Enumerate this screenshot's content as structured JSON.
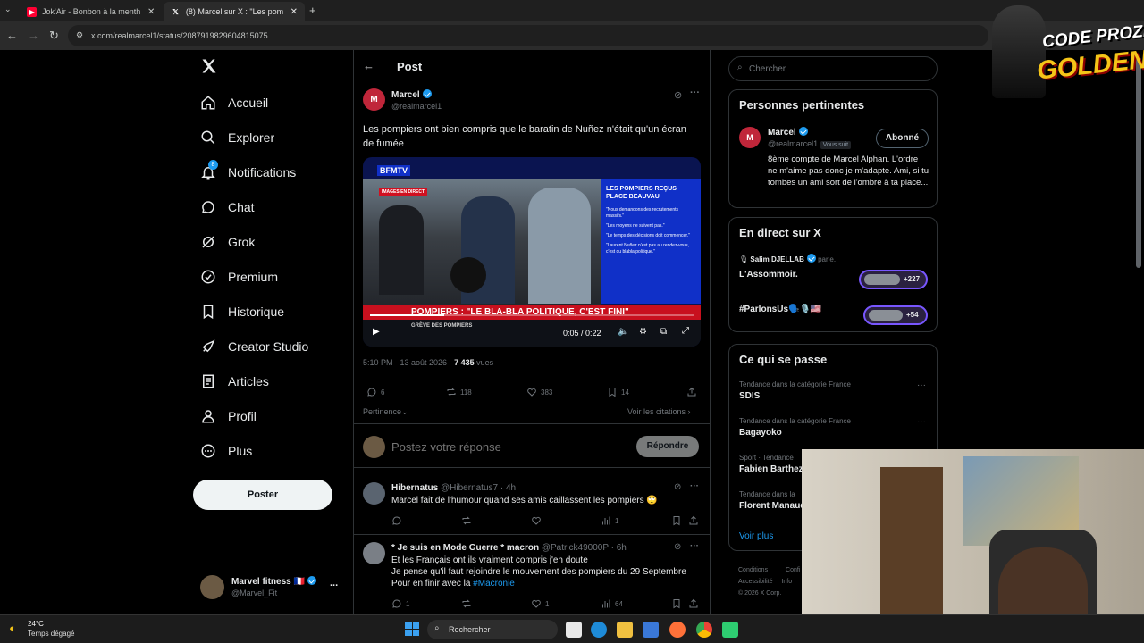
{
  "browser": {
    "tabs": [
      {
        "title": "Jok'Air - Bonbon à la menthe Ft",
        "active": false
      },
      {
        "title": "(8) Marcel sur X : \"Les pompiers",
        "active": true
      }
    ],
    "url": "x.com/realmarcel1/status/2087919829604815075"
  },
  "nav": {
    "items": [
      {
        "label": "Accueil",
        "icon": "home-icon"
      },
      {
        "label": "Explorer",
        "icon": "search-icon"
      },
      {
        "label": "Notifications",
        "icon": "bell-icon",
        "badge": "8"
      },
      {
        "label": "Chat",
        "icon": "chat-icon"
      },
      {
        "label": "Grok",
        "icon": "grok-icon"
      },
      {
        "label": "Premium",
        "icon": "premium-icon"
      },
      {
        "label": "Historique",
        "icon": "bookmark-icon"
      },
      {
        "label": "Creator Studio",
        "icon": "rocket-icon"
      },
      {
        "label": "Articles",
        "icon": "article-icon"
      },
      {
        "label": "Profil",
        "icon": "person-icon"
      },
      {
        "label": "Plus",
        "icon": "more-circle-icon"
      }
    ],
    "post_button": "Poster",
    "account": {
      "name": "Marvel fitness",
      "flag": "🇫🇷",
      "handle": "@Marvel_Fit",
      "more": "..."
    }
  },
  "header": {
    "title": "Post"
  },
  "post": {
    "author": "Marcel",
    "handle": "@realmarcel1",
    "text": "Les pompiers ont bien compris que le baratin de Nuñez n'était qu'un écran de fumée",
    "video": {
      "channel": "BFMTV",
      "label_live": "IMAGES EN DIRECT",
      "panel_title": "LES POMPIERS REÇUS PLACE BEAUVAU",
      "bullets": [
        "\"Nous demandons des recrutements massifs.\"",
        "\"Les moyens ne suivent pas.\"",
        "\"Le temps des décisions doit commencer.\"",
        "\"Laurent Nuñez n'est pas au rendez-vous, c'est du blabla politique.\""
      ],
      "headline": "POMPIERS : \"LE BLA-BLA POLITIQUE, C'EST FINI\"",
      "ticker_label": "GRÈVE DES POMPIERS",
      "time": "0:05 / 0:22"
    },
    "time": "5:10 PM · 13 août 2026 ·",
    "views_count": "7 435",
    "views_label": "vues",
    "replies": "6",
    "reposts": "118",
    "likes": "383",
    "bookmarks": "14",
    "relevance": "Pertinence",
    "quotes": "Voir les citations"
  },
  "composer": {
    "placeholder": "Postez votre réponse",
    "button": "Répondre"
  },
  "replies": [
    {
      "name": "Hibernatus",
      "handle": "@Hibernatus7",
      "time": "· 4h",
      "text": "Marcel fait de l'humour quand ses amis caillassent les pompiers 🙄",
      "views": "1"
    },
    {
      "name": "* Je suis en Mode Guerre * macron",
      "handle": "@Patrick49000P",
      "time": "· 6h",
      "lines": [
        "Et les Français ont ils vraiment compris j'en doute",
        "Je pense qu'il faut rejoindre le mouvement des pompiers du 29 Septembre"
      ],
      "last_line": "Pour en finir avec la",
      "hashtag": "#Macronie",
      "replies": "1",
      "likes": "1",
      "views": "64"
    }
  ],
  "sidebar": {
    "search_placeholder": "Chercher",
    "relevant": {
      "title": "Personnes pertinentes",
      "name": "Marcel",
      "handle": "@realmarcel1",
      "follows_you": "Vous suit",
      "button": "Abonné",
      "bio": "8ème compte de Marcel Alphan. L'ordre ne m'aime pas donc je m'adapte. Ami, si tu tombes un ami sort de l'ombre à ta place..."
    },
    "live": {
      "title": "En direct sur X",
      "host": "Salim DJELLAB",
      "host_suffix": "parle.",
      "spaces": [
        {
          "name": "L'Assommoir.",
          "count": "+227"
        },
        {
          "name": "#ParlonsUs🗣️🎙️🇺🇸",
          "count": "+54"
        }
      ]
    },
    "trends": {
      "title": "Ce qui se passe",
      "items": [
        {
          "category": "Tendance dans la catégorie France",
          "name": "SDIS"
        },
        {
          "category": "Tendance dans la catégorie France",
          "name": "Bagayoko"
        },
        {
          "category": "Sport · Tendance",
          "name": "Fabien Barthez"
        },
        {
          "category": "Tendance dans la",
          "name": "Florent Manaudou"
        }
      ],
      "more": "Voir plus"
    },
    "footer": [
      "Conditions",
      "Confi",
      "Accessibilité",
      "Info",
      "© 2026 X Corp."
    ]
  },
  "stream": {
    "brand_line1": "CODE PROZIS",
    "brand_line2": "GOLDENG"
  },
  "taskbar": {
    "temp": "24°C",
    "weather": "Temps dégagé",
    "search": "Rechercher"
  },
  "colors": {
    "accent": "#1d9bf0",
    "verified": "#1d9bf0",
    "panel_border": "#2f3336",
    "bfm_blue": "#1030c8",
    "bfm_red": "#d01020"
  }
}
